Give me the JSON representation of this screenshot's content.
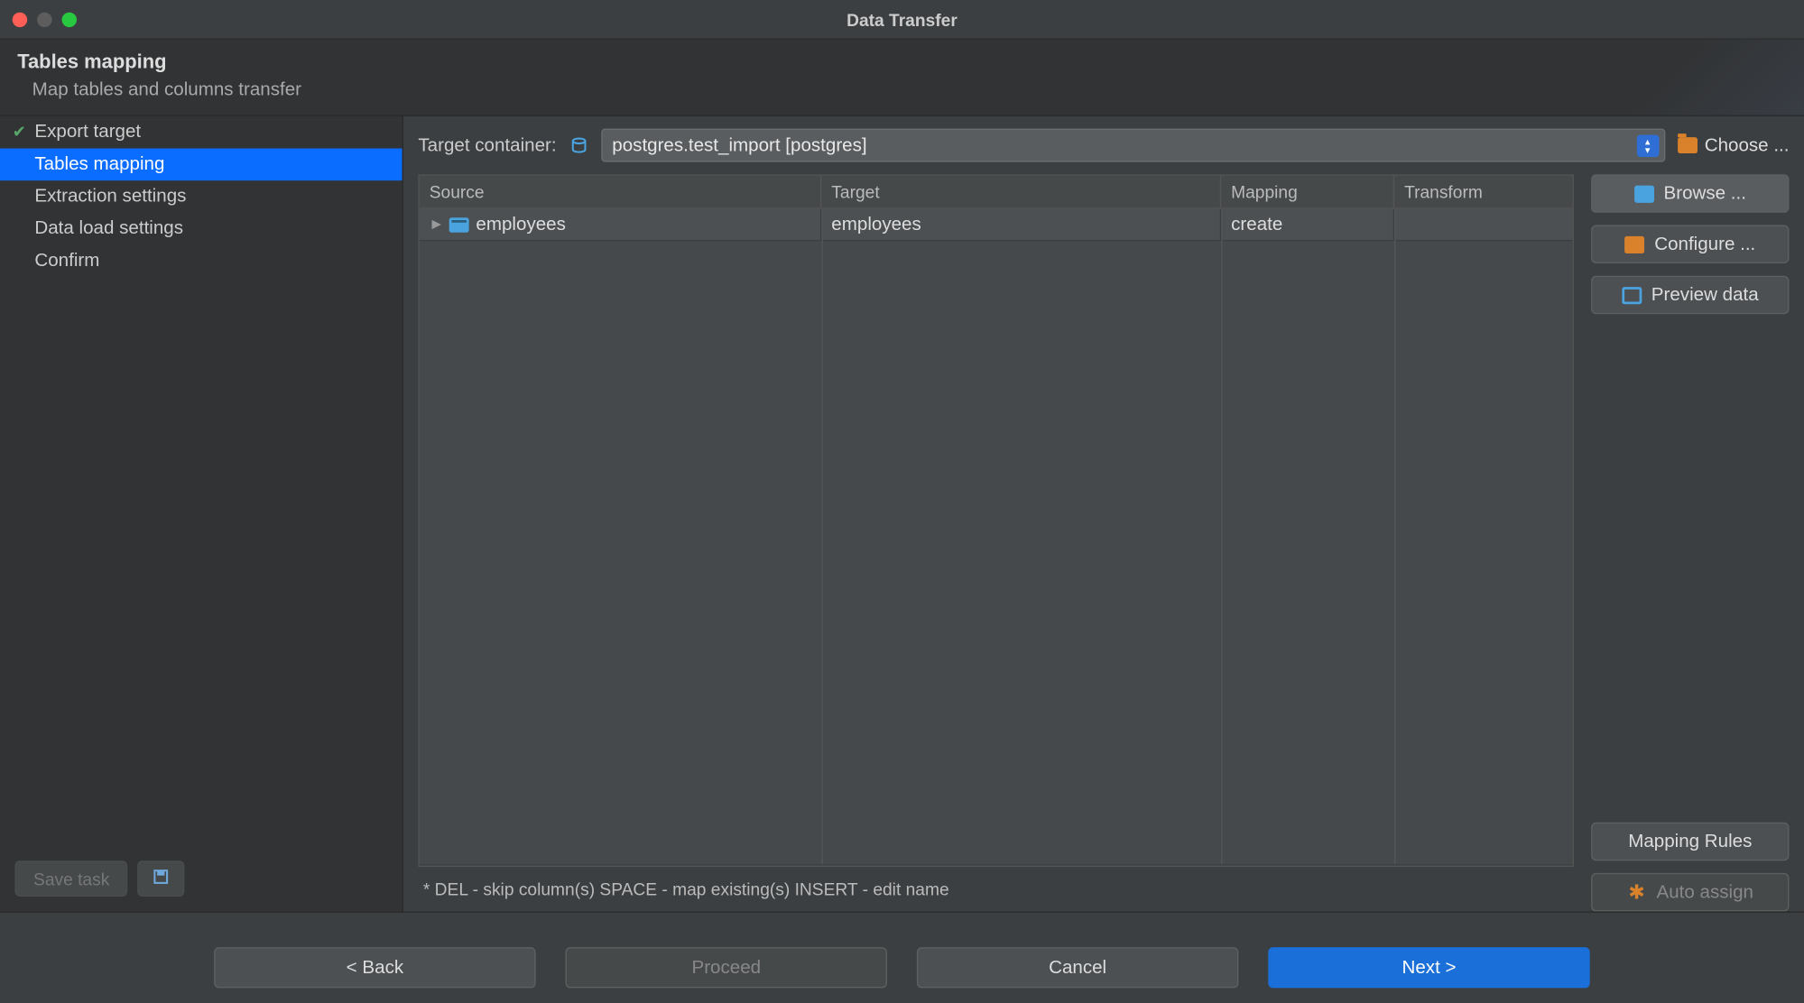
{
  "window": {
    "title": "Data Transfer"
  },
  "header": {
    "title": "Tables mapping",
    "subtitle": "Map tables and columns transfer"
  },
  "sidebar": {
    "steps": [
      {
        "label": "Export target",
        "state": "done"
      },
      {
        "label": "Tables mapping",
        "state": "active"
      },
      {
        "label": "Extraction settings",
        "state": ""
      },
      {
        "label": "Data load settings",
        "state": ""
      },
      {
        "label": "Confirm",
        "state": ""
      }
    ],
    "save_task_label": "Save task"
  },
  "target": {
    "label": "Target container:",
    "value": "postgres.test_import  [postgres]",
    "choose_label": "Choose ..."
  },
  "table": {
    "columns": {
      "source": "Source",
      "target": "Target",
      "mapping": "Mapping",
      "transform": "Transform"
    },
    "rows": [
      {
        "source": "employees",
        "target": "employees",
        "mapping": "create",
        "transform": ""
      }
    ]
  },
  "hint": "* DEL - skip column(s)  SPACE - map existing(s)  INSERT - edit name",
  "right_buttons": {
    "browse": "Browse ...",
    "configure": "Configure ...",
    "preview": "Preview data",
    "mapping_rules": "Mapping Rules",
    "auto_assign": "Auto assign"
  },
  "footer": {
    "back": "< Back",
    "proceed": "Proceed",
    "cancel": "Cancel",
    "next": "Next >"
  }
}
